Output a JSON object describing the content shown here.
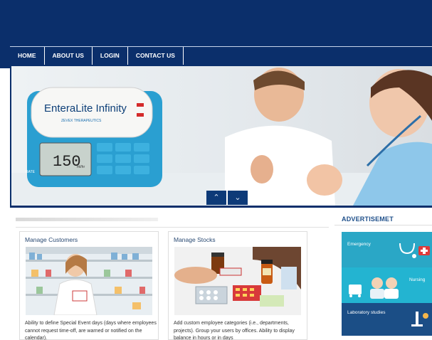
{
  "nav": {
    "items": [
      "HOME",
      "ABOUT US",
      "LOGIN",
      "CONTACT US"
    ]
  },
  "hero": {
    "device_brand": "EnteraLite Infinity",
    "device_maker": "ZEVEX THERAPEUTICS",
    "device_display": "150",
    "device_unit": "ml/hr",
    "device_side_label": "RATE",
    "carousel_up_icon": "chevron-up",
    "carousel_down_icon": "chevron-down"
  },
  "cards": [
    {
      "title": "Manage Customers",
      "text": "Ability to define Special Event days (days where employees cannot request time-off, are warned or notified on the calendar)."
    },
    {
      "title": "Manage Stocks",
      "text": "Add custom employee categories (i.e., departments, projects). Group your users by offices. Ability to display balance in hours or in days"
    }
  ],
  "ad": {
    "title": "ADVERTISEMET",
    "labels": [
      "Emergency",
      "Nursing",
      "Laboratory studies"
    ]
  },
  "colors": {
    "header": "#0b2f6b",
    "ad_cyan": "#2aa7c6",
    "ad_navy": "#1b4e86"
  }
}
